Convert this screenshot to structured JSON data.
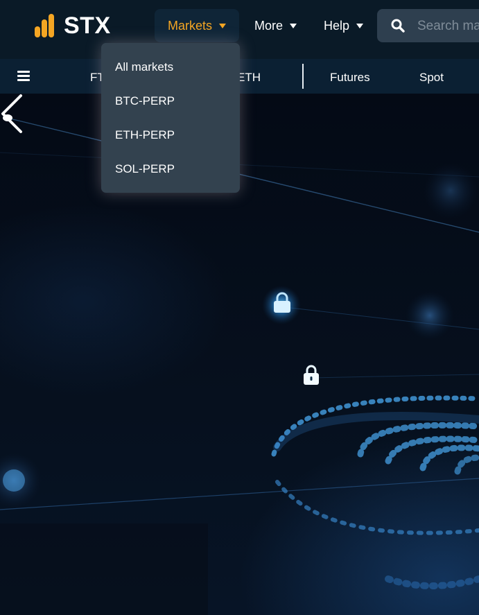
{
  "brand": {
    "name": "STX",
    "accent_color": "#f5a623"
  },
  "header": {
    "nav": [
      {
        "label": "Markets",
        "active": true
      },
      {
        "label": "More"
      },
      {
        "label": "Help"
      }
    ],
    "search": {
      "placeholder": "Search markets",
      "icon": "search-icon"
    }
  },
  "subnav": {
    "menu_icon": "hamburger-icon",
    "items": [
      {
        "label": "FT"
      },
      {
        "label": "ETH"
      },
      {
        "label": "Futures"
      },
      {
        "label": "Spot"
      }
    ]
  },
  "markets_dropdown": {
    "items": [
      {
        "label": "All markets"
      },
      {
        "label": "BTC-PERP"
      },
      {
        "label": "ETH-PERP"
      },
      {
        "label": "SOL-PERP"
      }
    ]
  },
  "hero": {
    "prev_icon": "chevron-left-icon",
    "decor_icons": [
      "lock-icon",
      "lock-icon"
    ]
  }
}
